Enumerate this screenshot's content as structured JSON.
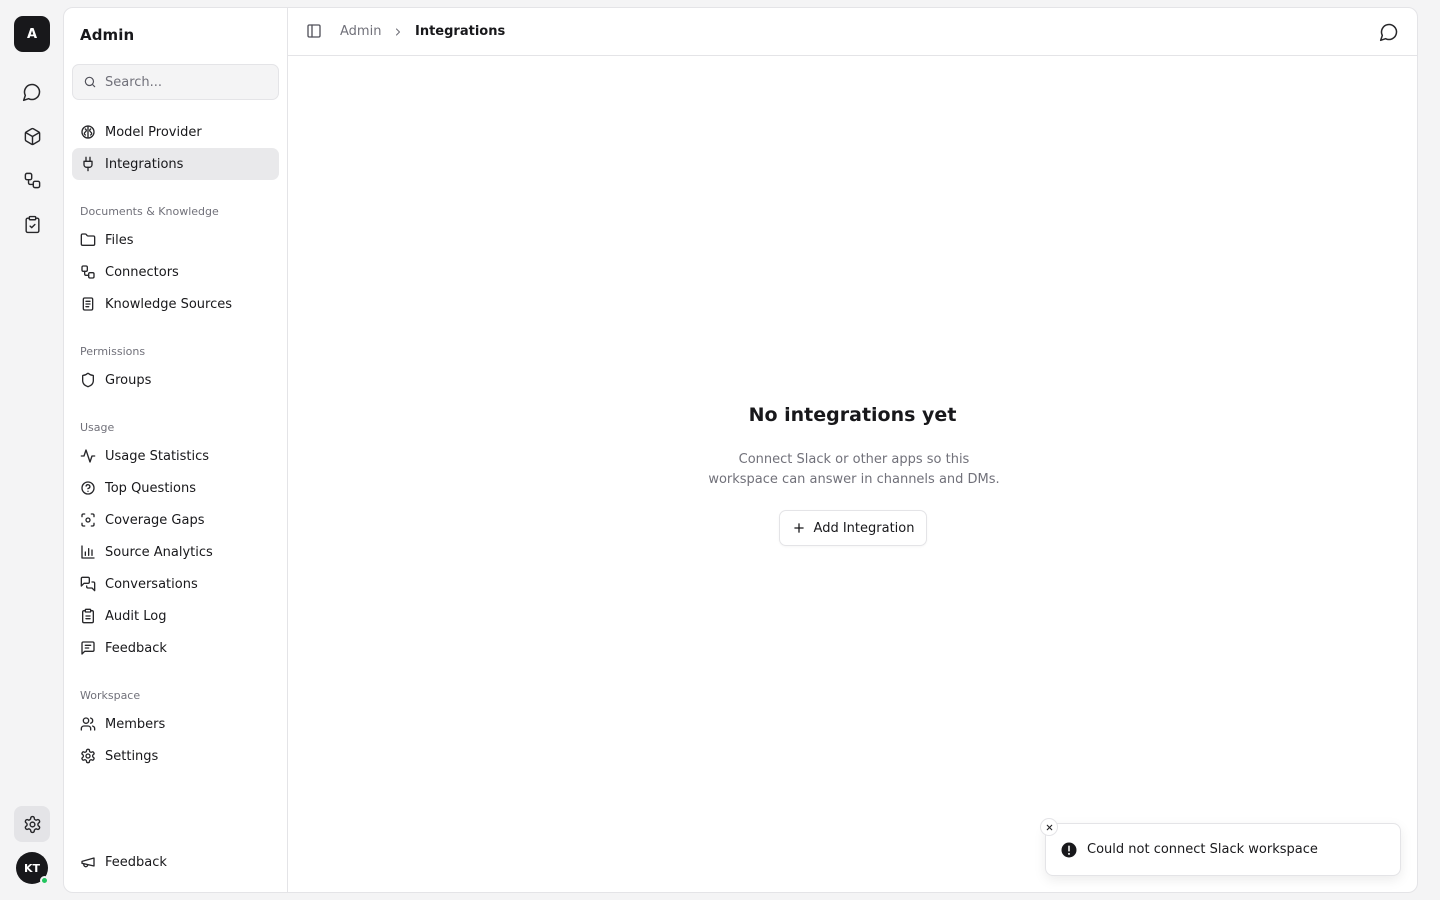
{
  "rail": {
    "logo": "A",
    "avatar": "KT",
    "items": [
      {
        "icon": "chat-bubble-icon"
      },
      {
        "icon": "cube-icon"
      },
      {
        "icon": "workflow-icon"
      },
      {
        "icon": "clipboard-check-icon"
      }
    ],
    "settings_icon": "gear-icon",
    "status_color": "#22c55e"
  },
  "sidebar": {
    "title": "Admin",
    "search_placeholder": "Search...",
    "top_items": [
      {
        "label": "Model Provider",
        "icon": "model-icon"
      },
      {
        "label": "Integrations",
        "icon": "plug-icon",
        "active": true
      }
    ],
    "sections": [
      {
        "title": "Documents & Knowledge",
        "items": [
          {
            "label": "Files",
            "icon": "folder-icon"
          },
          {
            "label": "Connectors",
            "icon": "connectors-icon"
          },
          {
            "label": "Knowledge Sources",
            "icon": "document-icon"
          }
        ]
      },
      {
        "title": "Permissions",
        "items": [
          {
            "label": "Groups",
            "icon": "shield-icon"
          }
        ]
      },
      {
        "title": "Usage",
        "items": [
          {
            "label": "Usage Statistics",
            "icon": "activity-icon"
          },
          {
            "label": "Top Questions",
            "icon": "question-icon"
          },
          {
            "label": "Coverage Gaps",
            "icon": "scan-icon"
          },
          {
            "label": "Source Analytics",
            "icon": "bar-chart-icon"
          },
          {
            "label": "Conversations",
            "icon": "conversations-icon"
          },
          {
            "label": "Audit Log",
            "icon": "clipboard-icon"
          },
          {
            "label": "Feedback",
            "icon": "message-square-icon"
          }
        ]
      },
      {
        "title": "Workspace",
        "items": [
          {
            "label": "Members",
            "icon": "users-icon"
          },
          {
            "label": "Settings",
            "icon": "gear-icon"
          }
        ]
      }
    ],
    "footer": {
      "label": "Feedback",
      "icon": "megaphone-icon"
    }
  },
  "header": {
    "breadcrumb_root": "Admin",
    "breadcrumb_current": "Integrations"
  },
  "empty_state": {
    "title": "No integrations yet",
    "description_line1": "Connect Slack or other apps so this",
    "description_line2": "workspace can answer in channels and DMs.",
    "button_label": "Add Integration"
  },
  "toast": {
    "message": "Could not connect Slack workspace",
    "type": "error"
  }
}
